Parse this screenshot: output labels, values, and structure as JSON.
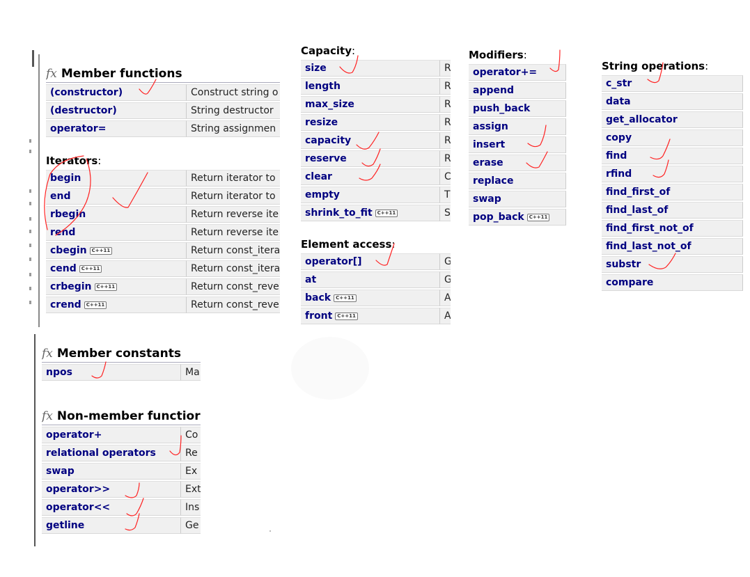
{
  "member_functions": {
    "title": "Member functions",
    "rows": [
      {
        "name": "(constructor)",
        "desc": "Construct string o"
      },
      {
        "name": "(destructor)",
        "desc": "String destructor"
      },
      {
        "name": "operator=",
        "desc": "String assignmen"
      }
    ]
  },
  "iterators": {
    "title": "Iterators",
    "rows": [
      {
        "name": "begin",
        "desc": "Return iterator to"
      },
      {
        "name": "end",
        "desc": "Return iterator to"
      },
      {
        "name": "rbegin",
        "desc": "Return reverse ite"
      },
      {
        "name": "rend",
        "desc": "Return reverse ite"
      },
      {
        "name": "cbegin",
        "desc": "Return const_itera",
        "badge": "C++11"
      },
      {
        "name": "cend",
        "desc": "Return const_itera",
        "badge": "C++11"
      },
      {
        "name": "crbegin",
        "desc": "Return const_reve",
        "badge": "C++11"
      },
      {
        "name": "crend",
        "desc": "Return const_reve",
        "badge": "C++11"
      }
    ]
  },
  "member_constants": {
    "title": "Member constants",
    "rows": [
      {
        "name": "npos",
        "desc": "Ma"
      }
    ]
  },
  "non_member_functions": {
    "title": "Non-member functior",
    "rows": [
      {
        "name": "operator+",
        "desc": "Co"
      },
      {
        "name": "relational operators",
        "desc": "Re"
      },
      {
        "name": "swap",
        "desc": "Ex"
      },
      {
        "name": "operator>>",
        "desc": "Ext"
      },
      {
        "name": "operator<<",
        "desc": "Ins"
      },
      {
        "name": "getline",
        "desc": "Ge"
      }
    ]
  },
  "capacity": {
    "title": "Capacity",
    "rows": [
      {
        "name": "size",
        "desc": "R"
      },
      {
        "name": "length",
        "desc": "R"
      },
      {
        "name": "max_size",
        "desc": "R"
      },
      {
        "name": "resize",
        "desc": "R"
      },
      {
        "name": "capacity",
        "desc": "R"
      },
      {
        "name": "reserve",
        "desc": "R"
      },
      {
        "name": "clear",
        "desc": "C"
      },
      {
        "name": "empty",
        "desc": "T"
      },
      {
        "name": "shrink_to_fit",
        "desc": "S",
        "badge": "C++11"
      }
    ]
  },
  "element_access": {
    "title": "Element access",
    "rows": [
      {
        "name": "operator[]",
        "desc": "G"
      },
      {
        "name": "at",
        "desc": "G"
      },
      {
        "name": "back",
        "desc": "A",
        "badge": "C++11"
      },
      {
        "name": "front",
        "desc": "A",
        "badge": "C++11"
      }
    ]
  },
  "modifiers": {
    "title": "Modifiers",
    "rows": [
      {
        "name": "operator+="
      },
      {
        "name": "append"
      },
      {
        "name": "push_back"
      },
      {
        "name": "assign"
      },
      {
        "name": "insert"
      },
      {
        "name": "erase"
      },
      {
        "name": "replace"
      },
      {
        "name": "swap"
      },
      {
        "name": "pop_back",
        "badge": "C++11"
      }
    ]
  },
  "string_operations": {
    "title": "String operations",
    "rows": [
      {
        "name": "c_str"
      },
      {
        "name": "data"
      },
      {
        "name": "get_allocator"
      },
      {
        "name": "copy"
      },
      {
        "name": "find"
      },
      {
        "name": "rfind"
      },
      {
        "name": "find_first_of"
      },
      {
        "name": "find_last_of"
      },
      {
        "name": "find_first_not_of"
      },
      {
        "name": "find_last_not_of"
      },
      {
        "name": "substr"
      },
      {
        "name": "compare"
      }
    ]
  },
  "colors": {
    "name_text": "#000080",
    "row_bg": "#f0f0f0",
    "check_marks": "#ff2222"
  },
  "icons": {
    "section": "fx-icon",
    "badge": "cpp11-badge-icon",
    "annotation": "checkmark-icon"
  }
}
